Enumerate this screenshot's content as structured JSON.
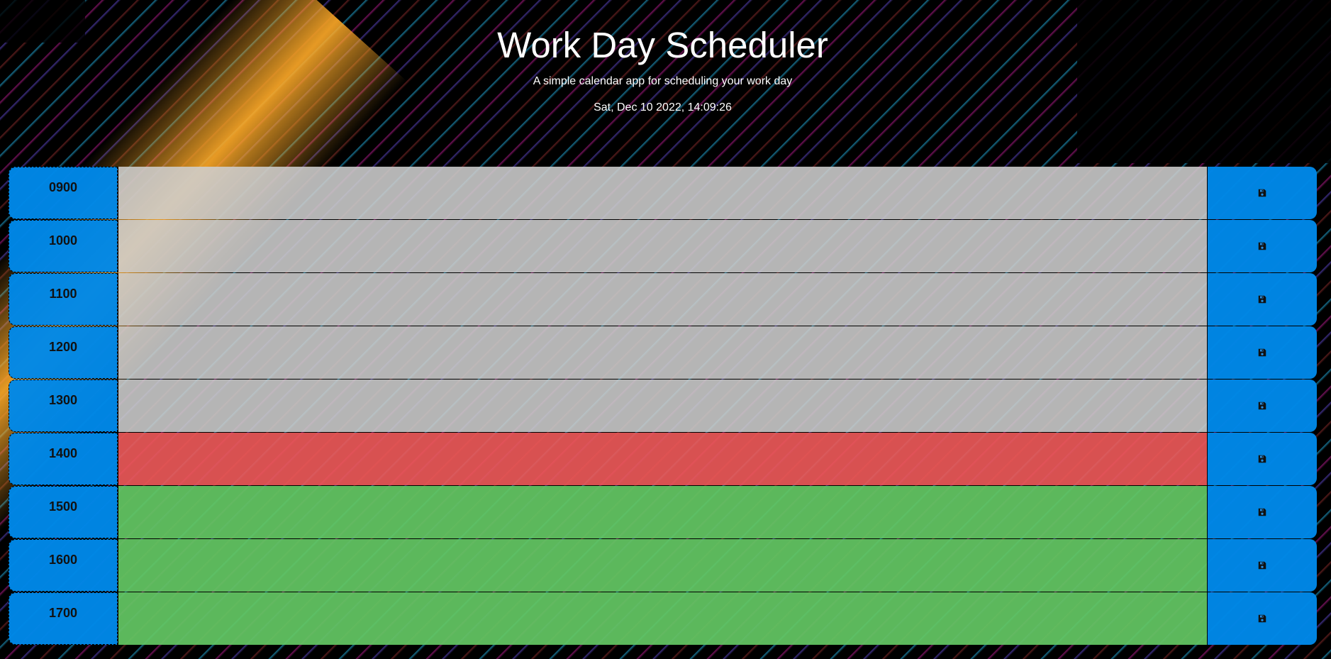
{
  "header": {
    "title": "Work Day Scheduler",
    "lead": "A simple calendar app for scheduling your work day",
    "current_day": "Sat, Dec 10 2022, 14:09:26"
  },
  "colors": {
    "past": "#cecece",
    "present": "#f05a5a",
    "future": "#64c864",
    "hour_block": "#0088e8"
  },
  "schedule": {
    "rows": [
      {
        "hour": "0900",
        "state": "past",
        "text": "",
        "save_icon": "save-icon"
      },
      {
        "hour": "1000",
        "state": "past",
        "text": "",
        "save_icon": "save-icon"
      },
      {
        "hour": "1100",
        "state": "past",
        "text": "",
        "save_icon": "save-icon"
      },
      {
        "hour": "1200",
        "state": "past",
        "text": "",
        "save_icon": "save-icon"
      },
      {
        "hour": "1300",
        "state": "past",
        "text": "",
        "save_icon": "save-icon"
      },
      {
        "hour": "1400",
        "state": "present",
        "text": "",
        "save_icon": "save-icon"
      },
      {
        "hour": "1500",
        "state": "future",
        "text": "",
        "save_icon": "save-icon"
      },
      {
        "hour": "1600",
        "state": "future",
        "text": "",
        "save_icon": "save-icon"
      },
      {
        "hour": "1700",
        "state": "future",
        "text": "",
        "save_icon": "save-icon"
      }
    ]
  }
}
